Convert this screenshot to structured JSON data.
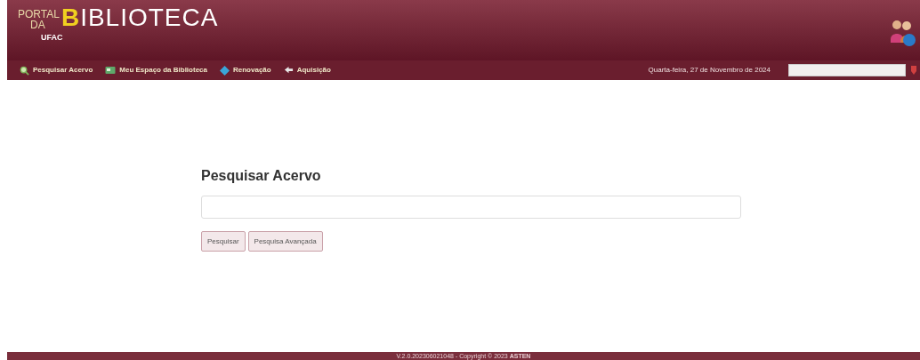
{
  "header": {
    "logo": {
      "top": "PORTAL",
      "middle": "DA",
      "initial": "B",
      "rest": "IBLIOTECA",
      "sub": "UFAC"
    }
  },
  "nav": {
    "items": [
      {
        "label": "Pesquisar Acervo"
      },
      {
        "label": "Meu Espaço da Biblioteca"
      },
      {
        "label": "Renovação"
      },
      {
        "label": "Aquisição"
      }
    ],
    "date": "Quarta-feira, 27 de Novembro de 2024"
  },
  "search": {
    "title": "Pesquisar Acervo",
    "buttons": [
      "Pesquisar",
      "Pesquisa Avançada"
    ]
  },
  "footer": {
    "text": "V.2.0.202306021048 - Copyright © 2023 **ASTEN**"
  }
}
